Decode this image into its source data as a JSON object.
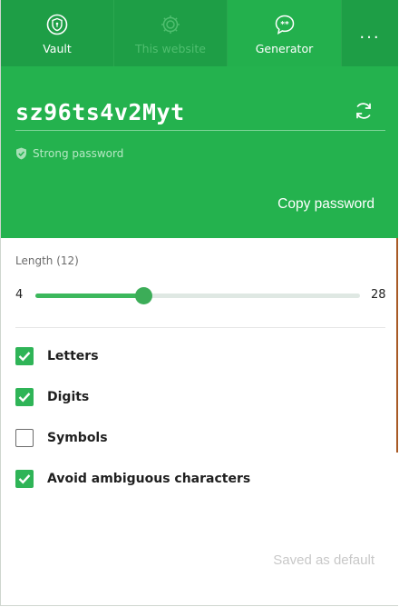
{
  "tabs": [
    {
      "label": "Vault",
      "icon": "shield-keyhole-icon",
      "state": "normal"
    },
    {
      "label": "This website",
      "icon": "gear-icon",
      "state": "disabled"
    },
    {
      "label": "Generator",
      "icon": "chat-password-icon",
      "state": "active"
    },
    {
      "label": "...",
      "icon": "more-icon",
      "state": "normal"
    }
  ],
  "generator": {
    "password": "sz96ts4v2Myt",
    "strength": "Strong password",
    "copy_label": "Copy password"
  },
  "settings": {
    "length_label": "Length (12)",
    "min": "4",
    "max": "28",
    "length_value": 12,
    "options": [
      {
        "label": "Letters",
        "checked": true
      },
      {
        "label": "Digits",
        "checked": true
      },
      {
        "label": "Symbols",
        "checked": false
      },
      {
        "label": "Avoid ambiguous characters",
        "checked": true
      }
    ],
    "saved_label": "Saved as default"
  },
  "colors": {
    "header": "#1e9e46",
    "active_tab": "#23b04d",
    "accent": "#2fb457"
  }
}
